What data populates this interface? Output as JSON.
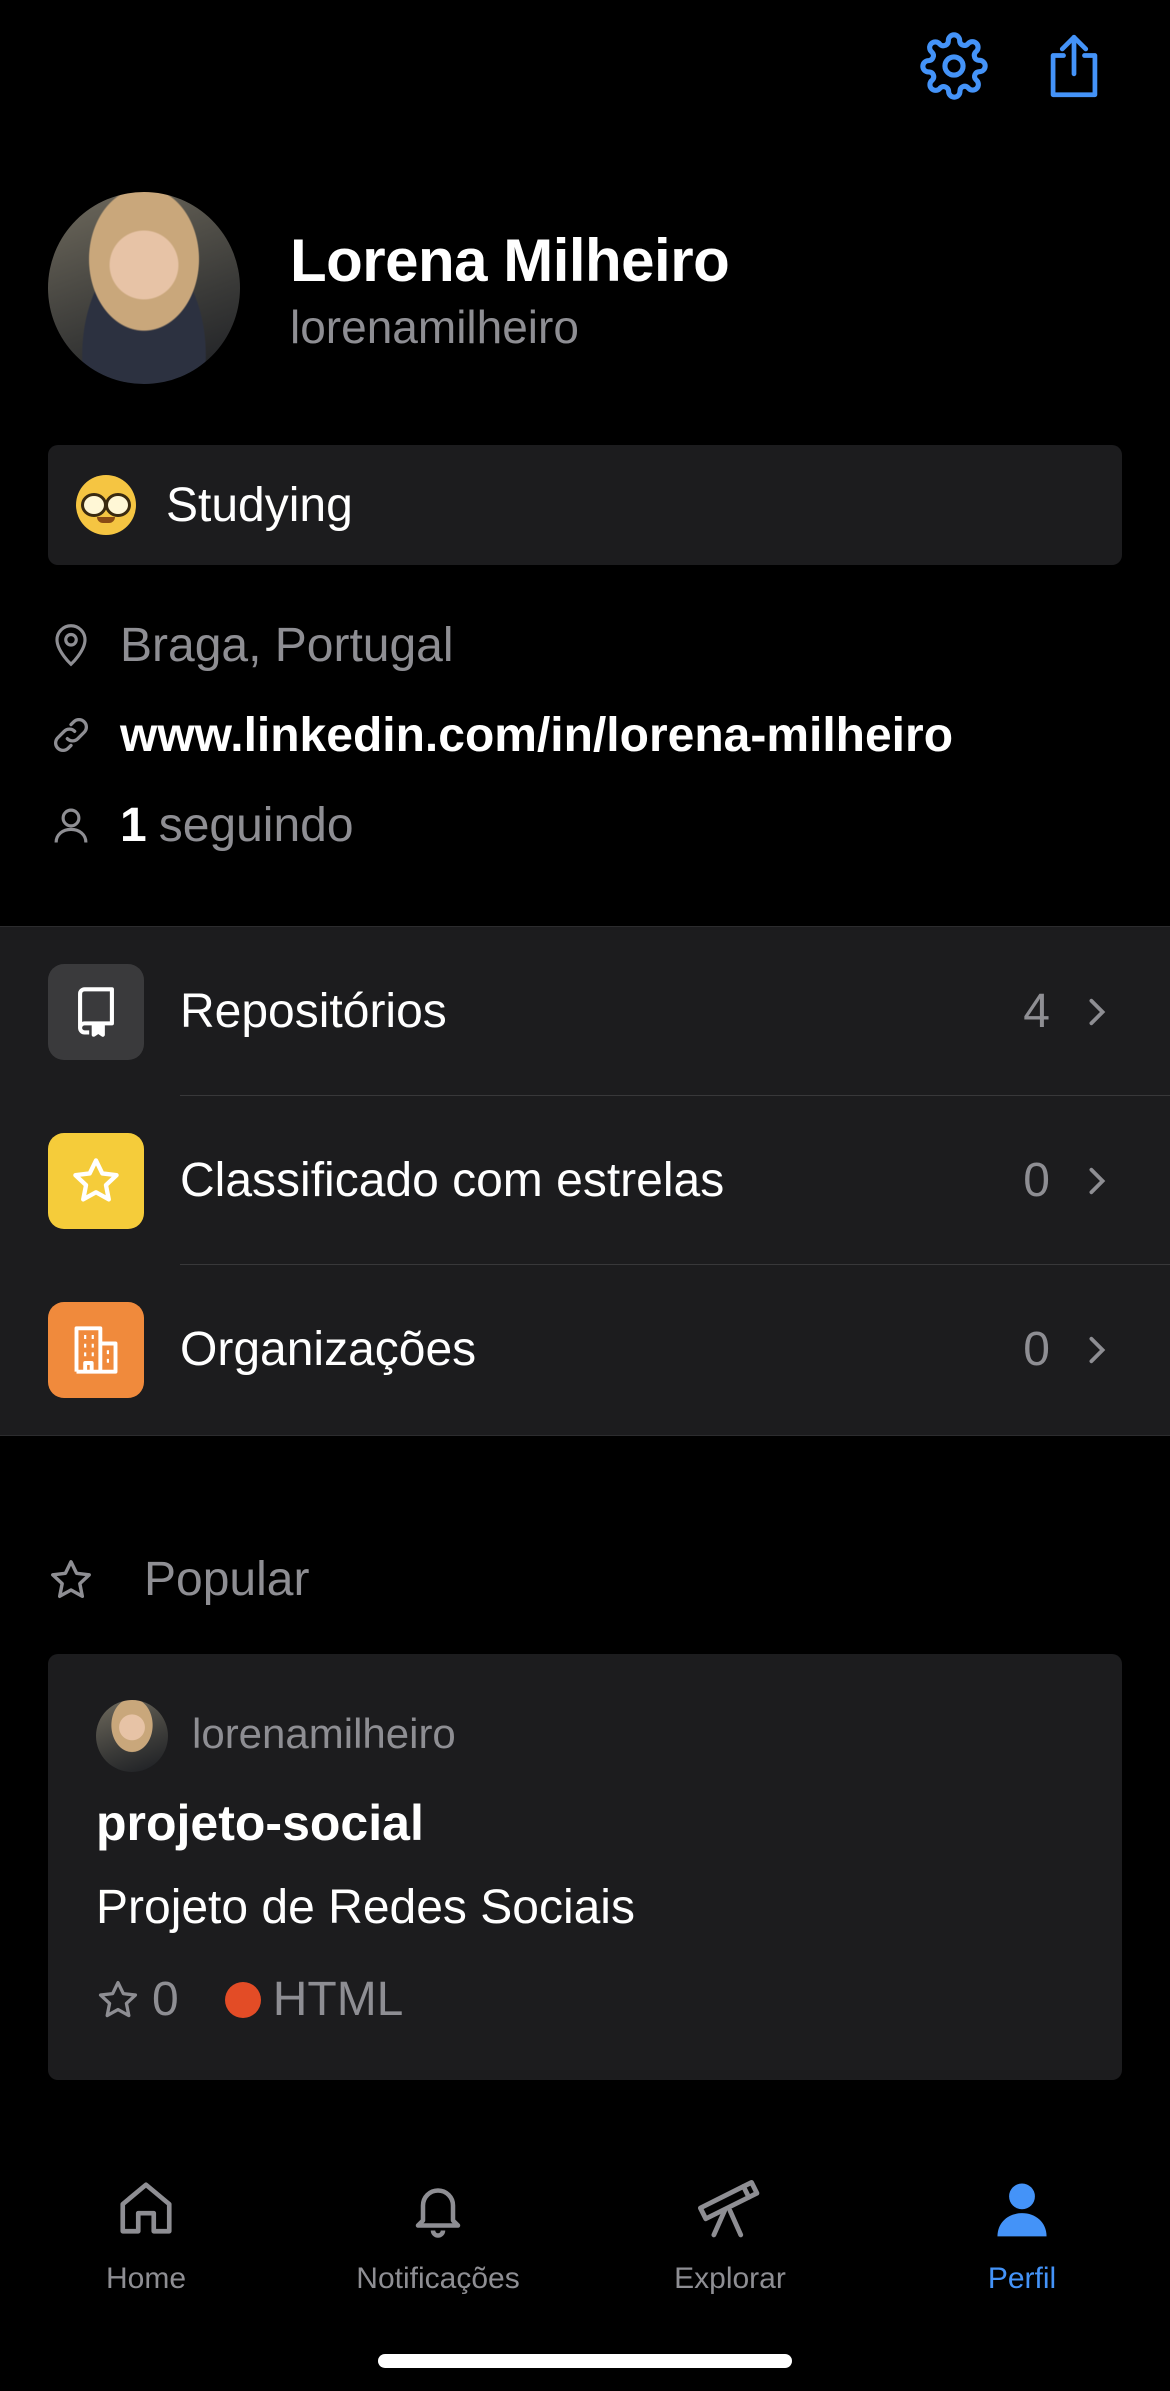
{
  "colors": {
    "accent": "#4493f8",
    "background": "#000000",
    "surface": "#1c1c1e",
    "secondary_text": "#8e8e93",
    "repos_tile": "#3a3a3c",
    "starred_tile": "#f5cc3a",
    "orgs_tile": "#f08a3c",
    "html_language": "#e34c26"
  },
  "toolbar": {
    "settings_icon": "gear-icon",
    "share_icon": "share-icon"
  },
  "profile": {
    "name": "Lorena Milheiro",
    "login": "lorenamilheiro"
  },
  "status": {
    "emoji": "nerd-face",
    "text": "Studying"
  },
  "info": {
    "location": "Braga, Portugal",
    "website": "www.linkedin.com/in/lorena-milheiro",
    "following_count": "1",
    "following_label": "seguindo"
  },
  "menu": [
    {
      "label": "Repositórios",
      "count": "4",
      "icon": "repo-icon"
    },
    {
      "label": "Classificado com estrelas",
      "count": "0",
      "icon": "star-icon"
    },
    {
      "label": "Organizações",
      "count": "0",
      "icon": "organization-icon"
    }
  ],
  "popular": {
    "title": "Popular",
    "card": {
      "owner": "lorenamilheiro",
      "repo": "projeto-social",
      "description": "Projeto de Redes Sociais",
      "stars": "0",
      "language": "HTML"
    }
  },
  "tabs": [
    {
      "label": "Home",
      "icon": "home-icon"
    },
    {
      "label": "Notificações",
      "icon": "bell-icon"
    },
    {
      "label": "Explorar",
      "icon": "telescope-icon"
    },
    {
      "label": "Perfil",
      "icon": "person-icon",
      "active": true
    }
  ]
}
